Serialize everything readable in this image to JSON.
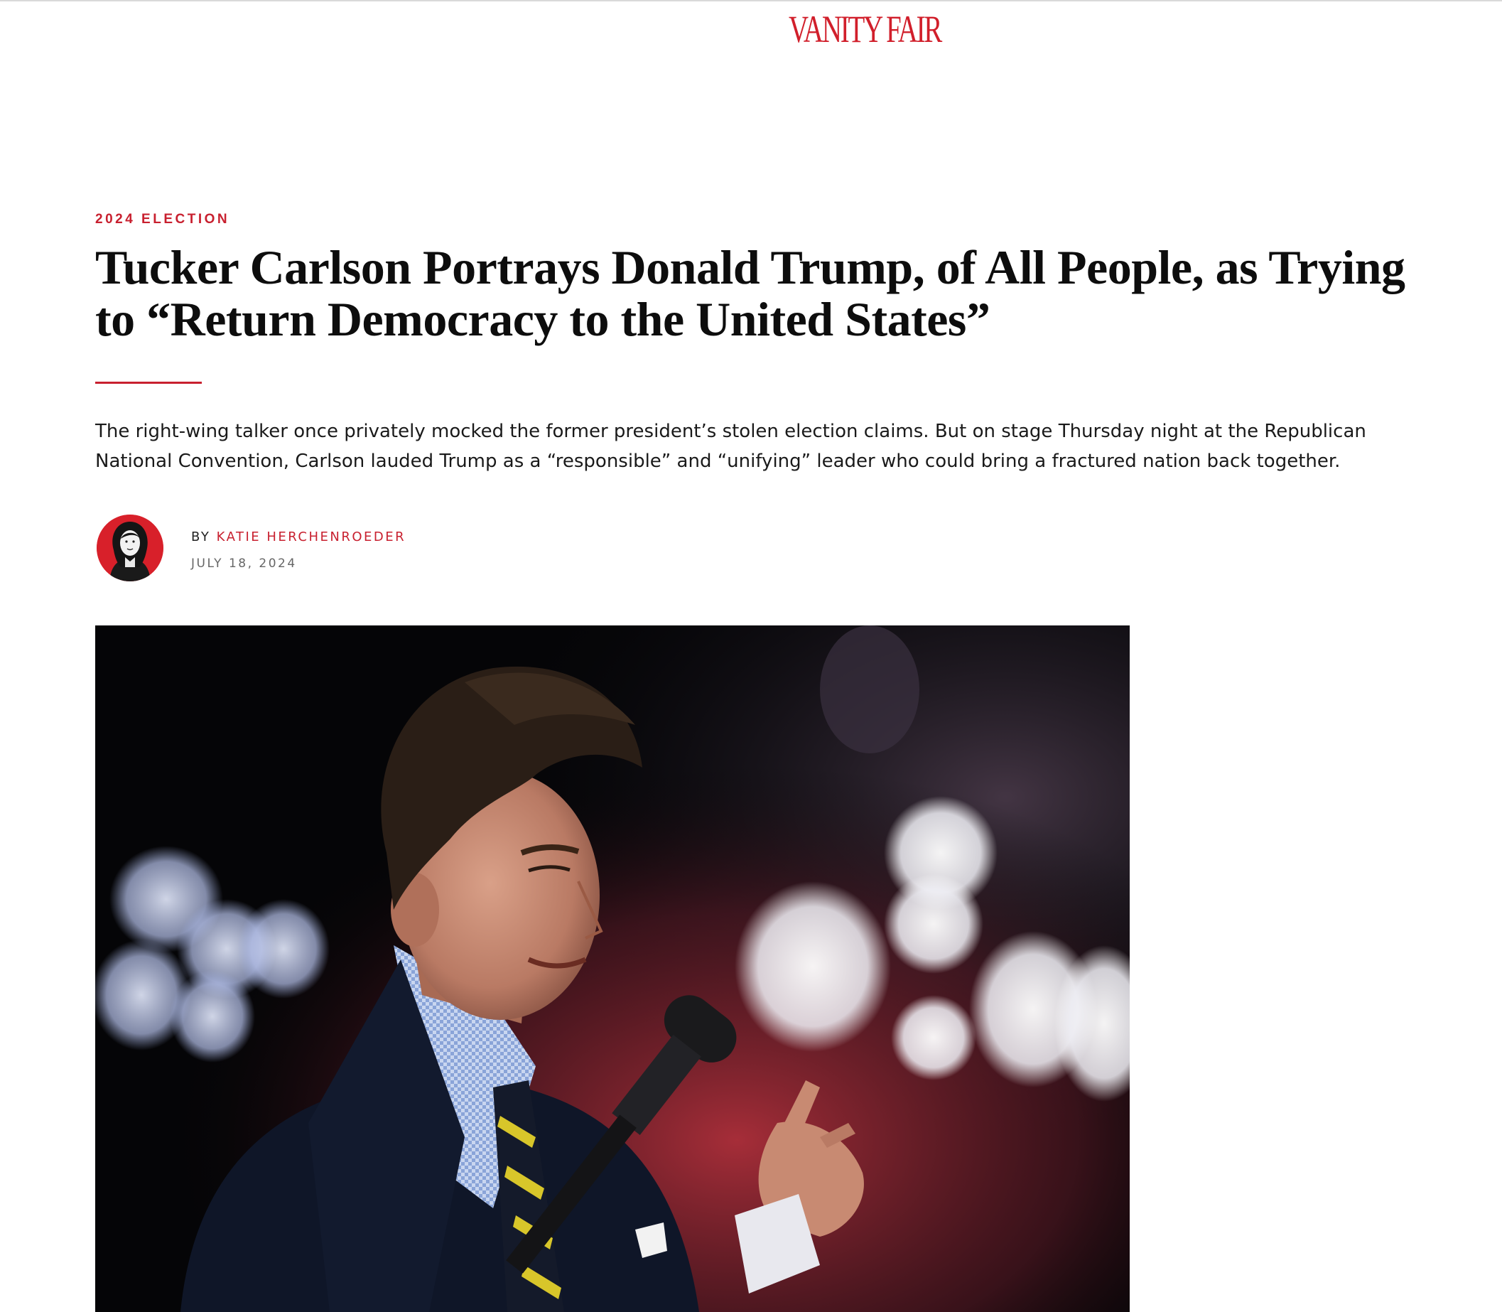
{
  "brand": {
    "logo_text": "VANITY FAIR",
    "accent_color": "#c8202f"
  },
  "article": {
    "rubric": "2024 ELECTION",
    "headline_line1": "Tucker Carlson Portrays Donald Trump, of All People, as Trying",
    "headline_line2": "to “Return Democracy to the United States”",
    "dek": "The right-wing talker once privately mocked the former president’s stolen election claims. But on stage Thursday night at the Republican National Convention, Carlson lauded Trump as a “responsible” and “unifying” leader who could bring a fractured nation back together.",
    "byline_prefix": "BY",
    "author": "KATIE HERCHENROEDER",
    "date": "JULY 18, 2024"
  },
  "media": {
    "avatar_icon": "author-portrait-icon",
    "hero_image": "photo of man speaking into microphone on stage with bokeh lights"
  }
}
